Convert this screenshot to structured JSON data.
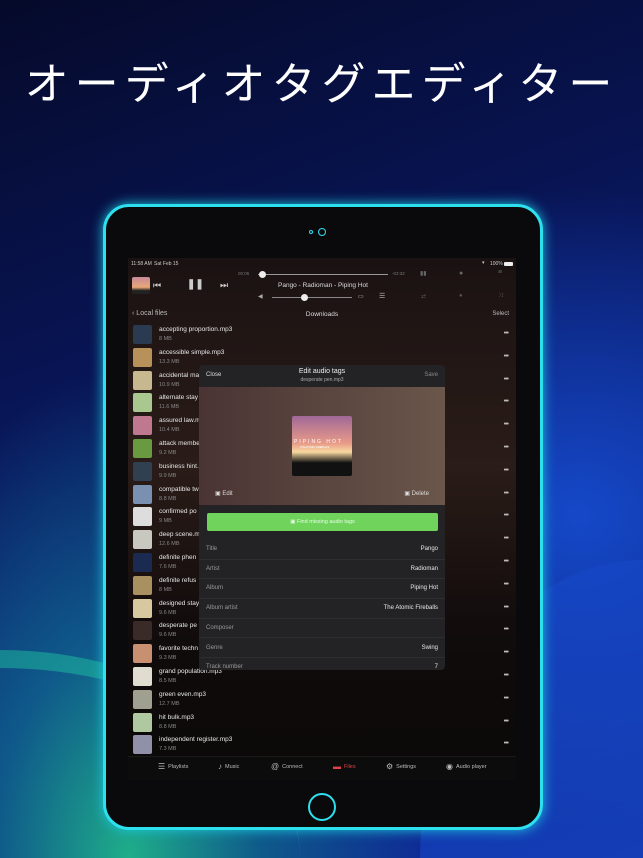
{
  "headline": "オーディオタグエディター",
  "status": {
    "time": "11:58 AM",
    "date": "Sat Feb 15",
    "battery": "100%"
  },
  "player": {
    "elapsed": "00:05",
    "remaining": "-03:32",
    "now_playing": "Pango - Radioman - Piping Hot",
    "progress": 0.03,
    "volume": 0.4
  },
  "nav": {
    "back": "Local files",
    "title": "Downloads",
    "select": "Select"
  },
  "files": [
    {
      "name": "accepting proportion.mp3",
      "size": "8 MB",
      "color": "#2a3a50"
    },
    {
      "name": "accessible simple.mp3",
      "size": "13.3 MB",
      "color": "#b8905a"
    },
    {
      "name": "accidental ma",
      "size": "10.9 MB",
      "color": "#c8b890"
    },
    {
      "name": "alternate stay",
      "size": "11.6 MB",
      "color": "#a8c890"
    },
    {
      "name": "assured law.m",
      "size": "10.4 MB",
      "color": "#c07890"
    },
    {
      "name": "attack membe",
      "size": "9.2 MB",
      "color": "#6a9a40"
    },
    {
      "name": "business hint.",
      "size": "9.9 MB",
      "color": "#304050"
    },
    {
      "name": "compatible tw",
      "size": "8.8 MB",
      "color": "#7a90b0"
    },
    {
      "name": "confirmed po",
      "size": "9 MB",
      "color": "#dddddd"
    },
    {
      "name": "deep scene.m",
      "size": "12.6 MB",
      "color": "#c8c8c0"
    },
    {
      "name": "definite phen",
      "size": "7.6 MB",
      "color": "#1a2a50"
    },
    {
      "name": "definite refus",
      "size": "8 MB",
      "color": "#a89060"
    },
    {
      "name": "designed stay",
      "size": "9.6 MB",
      "color": "#d8c8a0"
    },
    {
      "name": "desperate pe",
      "size": "9.6 MB",
      "color": "#3a2a28"
    },
    {
      "name": "favorite techn",
      "size": "9.3 MB",
      "color": "#c89070"
    },
    {
      "name": "grand population.mp3",
      "size": "8.5 MB",
      "color": "#e0dcd0"
    },
    {
      "name": "green even.mp3",
      "size": "12.7 MB",
      "color": "#a0a090"
    },
    {
      "name": "hit bulk.mp3",
      "size": "8.8 MB",
      "color": "#b0c8a0"
    },
    {
      "name": "independent register.mp3",
      "size": "7.3 MB",
      "color": "#9090a8"
    }
  ],
  "modal": {
    "close": "Close",
    "title": "Edit audio tags",
    "subtitle": "desperate pen.mp3",
    "save": "Save",
    "edit": "Edit",
    "delete": "Delete",
    "find": "Find missing audio tags",
    "album_art": {
      "title": "PIPING HOT",
      "sub": "THE ATOMIC FIREBALLS"
    },
    "fields": [
      {
        "label": "Title",
        "value": "Pango"
      },
      {
        "label": "Artist",
        "value": "Radioman"
      },
      {
        "label": "Album",
        "value": "Piping Hot"
      },
      {
        "label": "Album artist",
        "value": "The Atomic Fireballs"
      },
      {
        "label": "Composer",
        "value": ""
      },
      {
        "label": "Genre",
        "value": "Swing"
      },
      {
        "label": "Track number",
        "value": "7"
      }
    ]
  },
  "tabs": [
    {
      "label": "Playlists",
      "icon": "playlist-icon"
    },
    {
      "label": "Music",
      "icon": "music-icon"
    },
    {
      "label": "Connect",
      "icon": "connect-icon"
    },
    {
      "label": "Files",
      "icon": "folder-icon"
    },
    {
      "label": "Settings",
      "icon": "gear-icon"
    },
    {
      "label": "Audio player",
      "icon": "disc-icon"
    }
  ],
  "colors": {
    "accent_green": "#6fd35c",
    "active_tab": "#e0404a",
    "frame": "#2de0ee"
  }
}
